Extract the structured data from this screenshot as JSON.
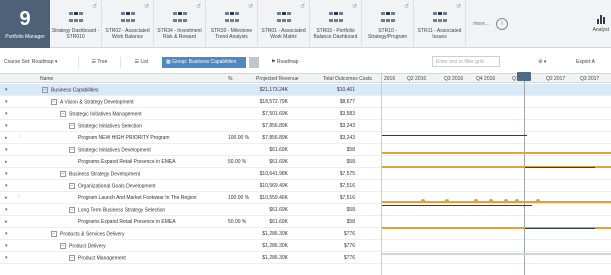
{
  "brand": {
    "number": "9",
    "label": "Portfolio Manager"
  },
  "tabs": [
    {
      "title": "Strategy Dashboard -\nSTR010"
    },
    {
      "title": "STR02 - Associated\nWork Balance"
    },
    {
      "title": "STR34 - Investment\nRisk & Reward"
    },
    {
      "title": "STR30 - Milestone\nTrend Analysis"
    },
    {
      "title": "STR01 - Associated\nWork Matrix"
    },
    {
      "title": "STR03 - Portfolio\nBalance Dashboard"
    },
    {
      "title": "STR10 -\nStrategy/Program"
    },
    {
      "title": "STR11 - Associated\nIssues"
    }
  ],
  "more_label": "more...",
  "analyst_label": "Analyst",
  "toolbar": {
    "course_set": "Course Set: Roadmap ▾",
    "tree": "☰ Tree",
    "list": "☰ List",
    "group": "▦ Group: Business Capabilities",
    "roadmap": "⚑ Roadmap",
    "filter_placeholder": "Enter text to filter grid",
    "gear": "⚙ ▾",
    "export": "Export A"
  },
  "header": {
    "name": "Name",
    "pct": "%",
    "projected_revenue": "Projected Revenue",
    "total_outcomes": "Total Outcomes Costs",
    "periods": [
      "2016",
      "Q2 2016",
      "Q3 2016",
      "Q4 2016",
      "Q1 2017",
      "Q2 2017",
      "Q3 2017"
    ]
  },
  "rows": [
    {
      "name": "Business Capabilities",
      "pct": "",
      "rev": "$21,173.24K",
      "tot": "$10,461",
      "indent": 0,
      "sel": true,
      "expander": "▾",
      "box": "−"
    },
    {
      "name": "A Vision & Strategy Development",
      "pct": "",
      "rev": "$18,572.79K",
      "tot": "$8,677",
      "indent": 1,
      "expander": "▾",
      "box": "−"
    },
    {
      "name": "Strategic Initiatives Management",
      "pct": "",
      "rev": "$7,501.69K",
      "tot": "$3,583",
      "indent": 2,
      "expander": "▾",
      "box": "−"
    },
    {
      "name": "Strategic Initiatives Selection",
      "pct": "",
      "rev": "$7,856.89K",
      "tot": "$3,243",
      "indent": 3,
      "expander": "▾",
      "box": "−"
    },
    {
      "name": "Program NEW HIGH PRIORITY Program",
      "pct": "100.00 %",
      "rev": "$7,856.89K",
      "tot": "$3,243",
      "indent": 4,
      "expander": "▸",
      "star": "☆"
    },
    {
      "name": "Strategic Initiatives Development",
      "pct": "",
      "rev": "$61.69K",
      "tot": "$58",
      "indent": 3,
      "expander": "▾",
      "box": "−"
    },
    {
      "name": "Programs Expand Retail Presence in EMEA",
      "pct": "50.00 %",
      "rev": "$61.69K",
      "tot": "$58",
      "indent": 4,
      "expander": "▸"
    },
    {
      "name": "Business Strategy Development",
      "pct": "",
      "rev": "$10,641.98K",
      "tot": "$7,575",
      "indent": 2,
      "expander": "▾",
      "box": "−"
    },
    {
      "name": "Organizational Goals Development",
      "pct": "",
      "rev": "$10,569.49K",
      "tot": "$7,516",
      "indent": 3,
      "expander": "▾",
      "box": "−"
    },
    {
      "name": "Program Launch And Market Footwear In The Region",
      "pct": "100.00 %",
      "rev": "$10,559.46K",
      "tot": "$7,516",
      "indent": 4,
      "expander": "▸",
      "star": "☆"
    },
    {
      "name": "Long Term Business Strategy Selection",
      "pct": "",
      "rev": "$61.69K",
      "tot": "$58",
      "indent": 3,
      "expander": "▾",
      "box": "−"
    },
    {
      "name": "Programs Expand Retail Presence in EMEA",
      "pct": "50.00 %",
      "rev": "$61.69K",
      "tot": "$58",
      "indent": 4,
      "expander": "▸"
    },
    {
      "name": "Products & Services Delivery",
      "pct": "",
      "rev": "$1,286.30K",
      "tot": "$776",
      "indent": 1,
      "expander": "▾",
      "box": "−"
    },
    {
      "name": "Product Delivery",
      "pct": "",
      "rev": "$1,286.30K",
      "tot": "$776",
      "indent": 2,
      "expander": "▾",
      "box": "−"
    },
    {
      "name": "Product Management",
      "pct": "",
      "rev": "$1,286.30K",
      "tot": "$776",
      "indent": 3,
      "expander": "▾",
      "box": "−"
    }
  ],
  "colors": {
    "accent": "#4e87c2",
    "brand_bg": "#4d6277",
    "gantt_orange": "#e5a03a",
    "gantt_dark": "#2c3e50"
  }
}
